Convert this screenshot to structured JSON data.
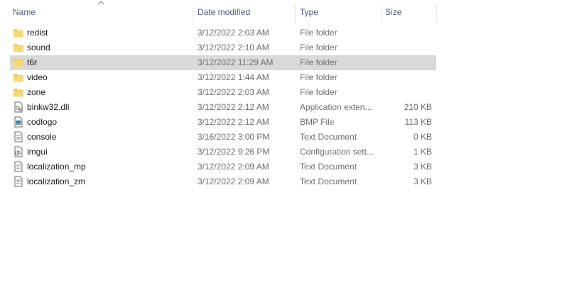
{
  "columns": {
    "name": "Name",
    "date": "Date modified",
    "type": "Type",
    "size": "Size"
  },
  "sort": {
    "column": "name",
    "direction": "ascending"
  },
  "colors": {
    "folder": "#f8d775",
    "folder_dark": "#e8b84a",
    "selected_row": "#d9d9d9",
    "header_text": "#4c607a"
  },
  "files": [
    {
      "name": "redist",
      "date": "3/12/2022 2:03 AM",
      "type": "File folder",
      "size": "",
      "icon": "folder-icon"
    },
    {
      "name": "sound",
      "date": "3/12/2022 2:10 AM",
      "type": "File folder",
      "size": "",
      "icon": "folder-icon"
    },
    {
      "name": "t6r",
      "date": "3/12/2022 11:29 AM",
      "type": "File folder",
      "size": "",
      "icon": "folder-icon",
      "selected": true
    },
    {
      "name": "video",
      "date": "3/12/2022 1:44 AM",
      "type": "File folder",
      "size": "",
      "icon": "folder-icon"
    },
    {
      "name": "zone",
      "date": "3/12/2022 2:03 AM",
      "type": "File folder",
      "size": "",
      "icon": "folder-icon"
    },
    {
      "name": "binkw32.dll",
      "date": "3/12/2022 2:12 AM",
      "type": "Application exten...",
      "size": "210 KB",
      "icon": "dll-file-icon"
    },
    {
      "name": "codlogo",
      "date": "3/12/2022 2:12 AM",
      "type": "BMP File",
      "size": "113 KB",
      "icon": "bmp-file-icon"
    },
    {
      "name": "console",
      "date": "3/16/2022 3:00 PM",
      "type": "Text Document",
      "size": "0 KB",
      "icon": "text-file-icon"
    },
    {
      "name": "imgui",
      "date": "3/12/2022 9:26 PM",
      "type": "Configuration sett...",
      "size": "1 KB",
      "icon": "config-file-icon"
    },
    {
      "name": "localization_mp",
      "date": "3/12/2022 2:09 AM",
      "type": "Text Document",
      "size": "3 KB",
      "icon": "text-file-icon"
    },
    {
      "name": "localization_zm",
      "date": "3/12/2022 2:09 AM",
      "type": "Text Document",
      "size": "3 KB",
      "icon": "text-file-icon"
    }
  ]
}
